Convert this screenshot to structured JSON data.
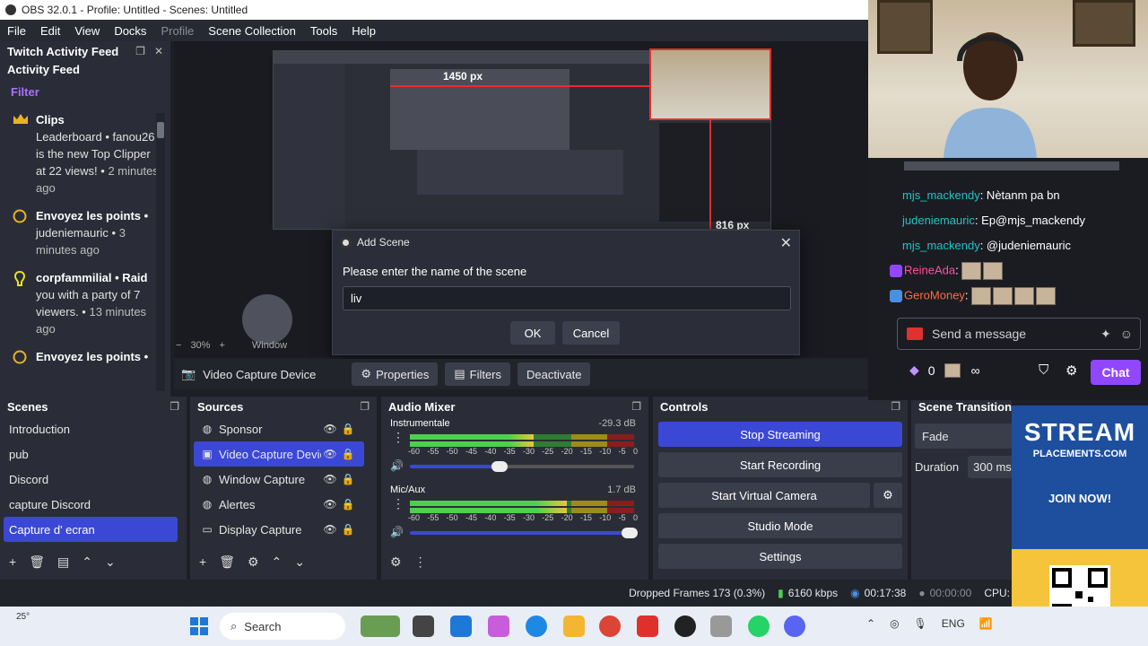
{
  "window": {
    "title": "OBS 32.0.1 - Profile: Untitled - Scenes: Untitled"
  },
  "menu": [
    "File",
    "Edit",
    "View",
    "Docks",
    "Profile",
    "Scene Collection",
    "Tools",
    "Help"
  ],
  "feed": {
    "dock_title": "Twitch Activity Feed",
    "subtitle": "Activity Feed",
    "filter": "Filter",
    "items": [
      {
        "icon": "crown-icon",
        "title": "Clips",
        "text": "Leaderboard • fanou26 is the new Top Clipper at 22 views! •",
        "ago": "2 minutes ago"
      },
      {
        "icon": "channel-points-icon",
        "title": "Envoyez les points •",
        "text": "judeniemauric •",
        "ago": "3 minutes ago"
      },
      {
        "icon": "raid-icon",
        "title": "corpfammilial • Raid",
        "text": "you with a party of 7 viewers. •",
        "ago": "13 minutes ago"
      },
      {
        "icon": "channel-points-icon",
        "title": "Envoyez les points •",
        "text": "",
        "ago": ""
      }
    ]
  },
  "preview": {
    "px_label_top": "1450 px",
    "px_label_side": "816 px",
    "zoom": "30%",
    "window_label": "Window"
  },
  "dialog": {
    "title": "Add Scene",
    "prompt": "Please enter the name of the scene",
    "value": "liv",
    "ok": "OK",
    "cancel": "Cancel"
  },
  "source_toolbar": {
    "source": "Video Capture Device",
    "properties": "Properties",
    "filters": "Filters",
    "deactivate": "Deactivate"
  },
  "scenes": {
    "title": "Scenes",
    "items": [
      "Introduction",
      "pub",
      "Discord",
      "capture Discord",
      "Capture d' ecran"
    ],
    "selected": 4
  },
  "sources": {
    "title": "Sources",
    "items": [
      {
        "name": "Sponsor",
        "icon": "globe-icon"
      },
      {
        "name": "Video Capture Devic",
        "icon": "camera-icon"
      },
      {
        "name": "Window Capture",
        "icon": "globe-icon"
      },
      {
        "name": "Alertes",
        "icon": "globe-icon"
      },
      {
        "name": "Display Capture",
        "icon": "monitor-icon"
      }
    ],
    "selected": 1
  },
  "mixer": {
    "title": "Audio Mixer",
    "scale": [
      "-60",
      "-55",
      "-50",
      "-45",
      "-40",
      "-35",
      "-30",
      "-25",
      "-20",
      "-15",
      "-10",
      "-5",
      "0"
    ],
    "channels": [
      {
        "name": "Instrumentale",
        "db": "-29.3 dB",
        "level": 0.55,
        "volume": 0.4
      },
      {
        "name": "Mic/Aux",
        "db": "1.7 dB",
        "level": 0.7,
        "volume": 0.98
      }
    ]
  },
  "controls": {
    "title": "Controls",
    "stop_streaming": "Stop Streaming",
    "start_recording": "Start Recording",
    "start_virtual_camera": "Start Virtual Camera",
    "studio_mode": "Studio Mode",
    "settings": "Settings"
  },
  "transitions": {
    "title": "Scene Transitions",
    "type": "Fade",
    "duration_label": "Duration",
    "duration_value": "300 ms"
  },
  "status": {
    "dropped": "Dropped Frames 173 (0.3%)",
    "bitrate": "6160 kbps",
    "stream_time": "00:17:38",
    "rec_time": "00:00:00",
    "cpu": "CPU:"
  },
  "chat": {
    "lines": [
      {
        "user": "mjs_mackendy",
        "text": ": Nètanm pa bn"
      },
      {
        "user": "judeniemauric",
        "text": ": Ep@mjs_mackendy"
      },
      {
        "user": "mjs_mackendy",
        "text": ": @judeniemauric"
      },
      {
        "user": "ReineAda",
        "text": ":"
      },
      {
        "user": "GeroMoney",
        "text": ":"
      }
    ],
    "input_placeholder": "Send a message",
    "points": "0",
    "chat_button": "Chat"
  },
  "ad": {
    "line1": "STREAM",
    "line2": "PLACEMENTS.COM",
    "line3": "JOIN NOW!"
  },
  "taskbar": {
    "weather": "25°",
    "search": "Search",
    "lang": "ENG"
  },
  "colors": {
    "accent": "#3b48d6",
    "twitch": "#9147ff",
    "panel": "#2a2d37"
  }
}
